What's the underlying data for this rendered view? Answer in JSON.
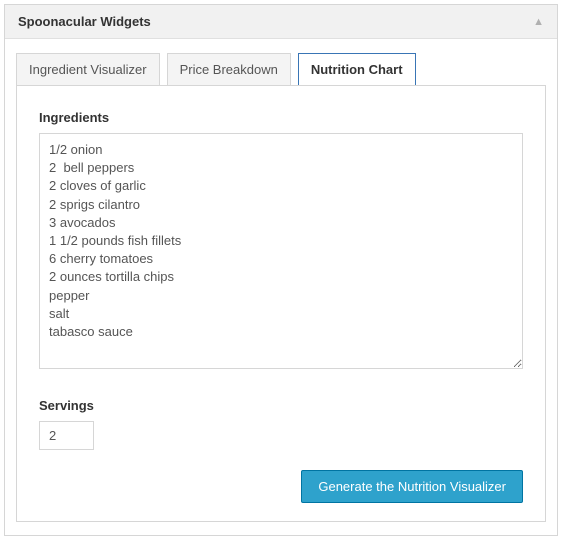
{
  "header": {
    "title": "Spoonacular Widgets"
  },
  "tabs": {
    "items": [
      {
        "label": "Ingredient Visualizer",
        "active": false
      },
      {
        "label": "Price Breakdown",
        "active": false
      },
      {
        "label": "Nutrition Chart",
        "active": true
      }
    ]
  },
  "form": {
    "ingredients_label": "Ingredients",
    "ingredients_value": "1/2 onion\n2  bell peppers\n2 cloves of garlic\n2 sprigs cilantro\n3 avocados\n1 1/2 pounds fish fillets\n6 cherry tomatoes\n2 ounces tortilla chips\npepper\nsalt\ntabasco sauce",
    "servings_label": "Servings",
    "servings_value": "2",
    "generate_button": "Generate the Nutrition Visualizer"
  }
}
